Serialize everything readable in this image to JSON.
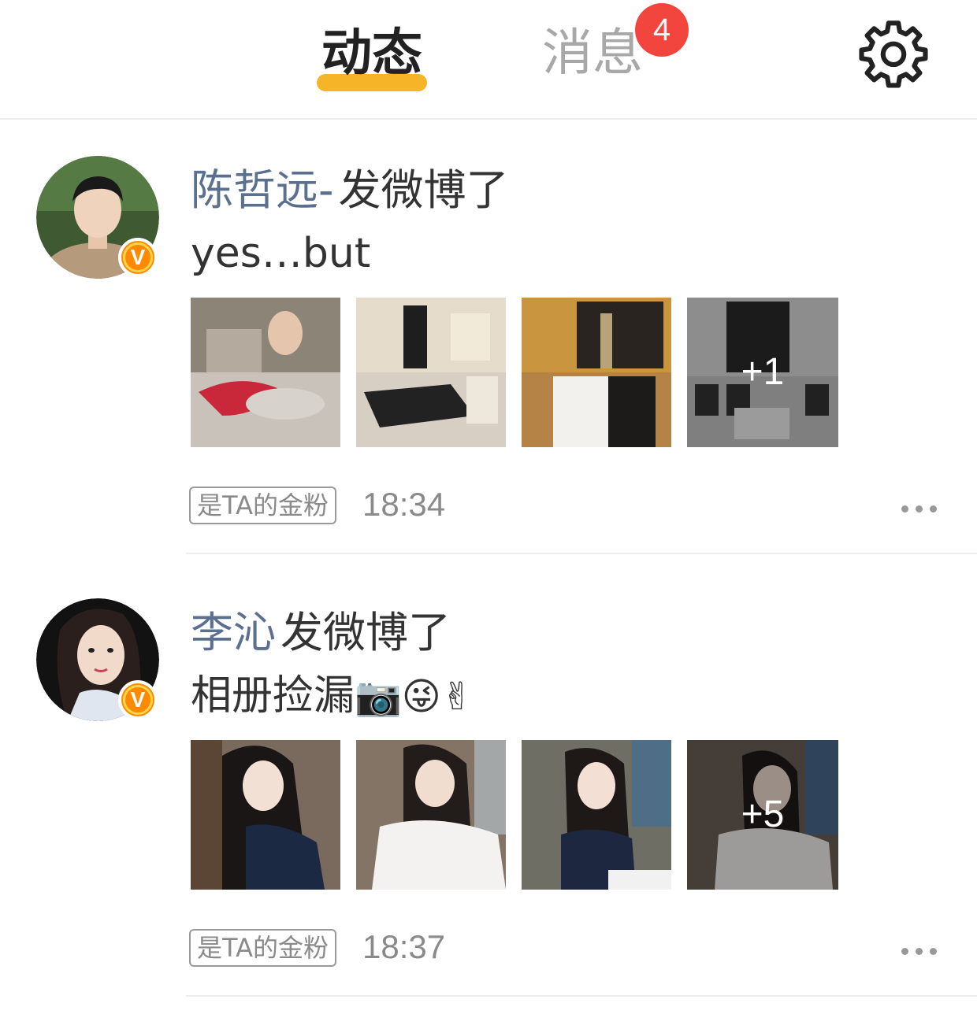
{
  "header": {
    "tab_feed": "动态",
    "tab_messages": "消息",
    "messages_badge": "4",
    "accent_color": "#f6b428",
    "badge_color": "#f2453d",
    "settings_icon": "gear-icon"
  },
  "posts": [
    {
      "author": "陈哲远-",
      "action": "发微博了",
      "text": "yes…but",
      "emojis": "",
      "more_photos": "+1",
      "fan_tag": "是TA的金粉",
      "time": "18:34",
      "verified_icon": "v-badge-icon",
      "more_icon": "more-dots-icon"
    },
    {
      "author": "李沁",
      "action": "发微博了",
      "text": "相册捡漏",
      "emojis": "📷😜✌",
      "more_photos": "+5",
      "fan_tag": "是TA的金粉",
      "time": "18:37",
      "verified_icon": "v-badge-icon",
      "more_icon": "more-dots-icon"
    }
  ]
}
